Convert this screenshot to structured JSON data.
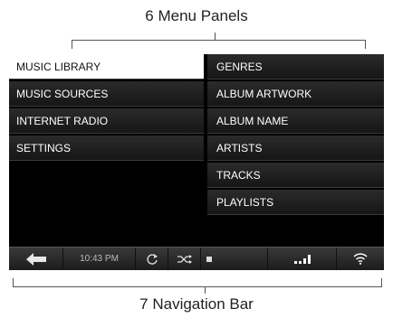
{
  "callouts": {
    "top": "6 Menu Panels",
    "bottom": "7 Navigation Bar"
  },
  "left_menu": [
    {
      "label": "MUSIC LIBRARY",
      "active": true
    },
    {
      "label": "MUSIC SOURCES",
      "active": false
    },
    {
      "label": "INTERNET RADIO",
      "active": false
    },
    {
      "label": "SETTINGS",
      "active": false
    }
  ],
  "right_menu": [
    {
      "label": "GENRES"
    },
    {
      "label": "ALBUM ARTWORK"
    },
    {
      "label": "ALBUM NAME"
    },
    {
      "label": "ARTISTS"
    },
    {
      "label": "TRACKS"
    },
    {
      "label": "PLAYLISTS"
    }
  ],
  "navbar": {
    "time": "10:43 PM",
    "icons": [
      "back-arrow-icon",
      "repeat-icon",
      "shuffle-icon",
      "stop-icon",
      "signal-strength-icon",
      "wifi-icon"
    ]
  },
  "colors": {
    "screen_bg": "#000000",
    "active_item_bg": "#ffffff",
    "menu_text": "#ffffff"
  }
}
